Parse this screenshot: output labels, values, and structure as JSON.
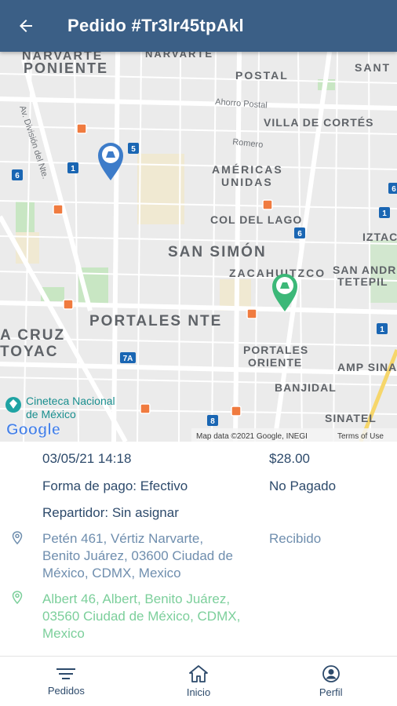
{
  "header": {
    "title": "Pedido #Tr3lr45tpAkl"
  },
  "map": {
    "labels": {
      "narvarte_poniente_1": "NARVARTE",
      "narvarte_poniente_2": "PONIENTE",
      "narvarte_top": "NARVARTE",
      "postal": "POSTAL",
      "santa": "SANT",
      "ahorro_postal": "Ahorro Postal",
      "villa_de_cortes": "VILLA DE CORTÉS",
      "romero": "Romero",
      "americas_unidas_1": "AMÉRICAS",
      "americas_unidas_2": "UNIDAS",
      "division_del_norte": "Av. División del Nte.",
      "col_del_lago": "COL DEL LAGO",
      "san_simon": "SAN SIMÓN",
      "zacahuitzco": "ZACAHUITZCO",
      "iztac": "IZTAC",
      "san_andres_1": "SAN ANDR",
      "san_andres_2": "TETEPIL",
      "portales_nte": "PORTALES NTE",
      "santa_cruz_1": "A CRUZ",
      "santa_cruz_2": "TOYAC",
      "portales_oriente_1": "PORTALES",
      "portales_oriente_2": "ORIENTE",
      "amp_sinatel": "AMP SINA",
      "banjidal": "BANJIDAL",
      "sinatel": "SINATEL",
      "cineteca_1": "Cineteca Nacional",
      "cineteca_2": "de México",
      "google": "Google",
      "attribution": "Map data ©2021 Google, INEGI",
      "terms": "Terms of Use"
    },
    "badges": {
      "b5": "5",
      "b1a": "1",
      "b6a": "6",
      "b6b": "6",
      "b1b": "1",
      "b6c": "6",
      "b7a": "7A",
      "b8": "8",
      "b1c": "1"
    },
    "colors": {
      "origin_pin": "#3d7cc9",
      "destination_pin": "#3cb878"
    }
  },
  "order": {
    "datetime": "03/05/21 14:18",
    "total": "$28.00",
    "payment_method": "Forma de pago: Efectivo",
    "payment_status": "No Pagado",
    "courier": "Repartidor: Sin asignar",
    "pickup_address": [
      "Petén 461, Vértiz Narvarte,",
      "Benito Juárez, 03600 Ciudad de",
      "México, CDMX, Mexico"
    ],
    "order_status": "Recibido",
    "delivery_address": [
      "Albert 46, Albert, Benito Juárez,",
      "03560 Ciudad de México, CDMX,",
      "Mexico"
    ]
  },
  "nav": {
    "pedidos": "Pedidos",
    "inicio": "Inicio",
    "perfil": "Perfil"
  },
  "icons": {
    "back": "arrow-left-icon",
    "orders": "list-icon",
    "home": "home-icon",
    "profile": "account-circle-icon",
    "pin": "map-marker-outline-icon"
  }
}
